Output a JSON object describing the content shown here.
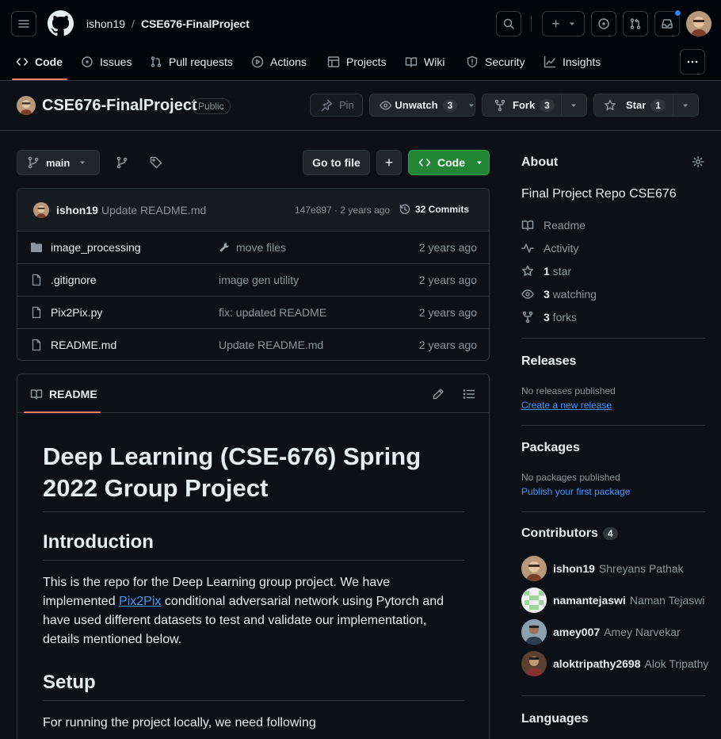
{
  "header": {
    "owner": "ishon19",
    "separator": "/",
    "repo": "CSE676-FinalProject",
    "plus_label": "+"
  },
  "nav": {
    "code": "Code",
    "issues": "Issues",
    "pulls": "Pull requests",
    "actions": "Actions",
    "projects": "Projects",
    "wiki": "Wiki",
    "security": "Security",
    "insights": "Insights"
  },
  "repo": {
    "name": "CSE676-FinalProject",
    "visibility": "Public",
    "pin": "Pin",
    "unwatch": "Unwatch",
    "watch_count": "3",
    "fork": "Fork",
    "fork_count": "3",
    "star": "Star",
    "star_count": "1"
  },
  "toolbar": {
    "branch": "main",
    "go_to_file": "Go to file",
    "add": "+",
    "code": "Code"
  },
  "commit": {
    "author": "ishon19",
    "message": "Update README.md",
    "hash_time": "147e897 · 2 years ago",
    "commits": "32 Commits"
  },
  "files": [
    {
      "name": "image_processing",
      "type": "folder",
      "message": "move files",
      "date": "2 years ago"
    },
    {
      "name": ".gitignore",
      "type": "file",
      "message": "image gen utility",
      "date": "2 years ago"
    },
    {
      "name": "Pix2Pix.py",
      "type": "file",
      "message": "fix: updated README",
      "date": "2 years ago"
    },
    {
      "name": "README.md",
      "type": "file",
      "message": "Update README.md",
      "date": "2 years ago"
    }
  ],
  "readme": {
    "tab": "README",
    "title": "Deep Learning (CSE-676) Spring 2022 Group Project",
    "intro_heading": "Introduction",
    "intro_p1": "This is the repo for the Deep Learning group project. We have implemented ",
    "intro_link": "Pix2Pix",
    "intro_p2": " conditional adversarial network using Pytorch and have used different datasets to test and validate our implementation, details mentioned below.",
    "setup_heading": "Setup",
    "setup_p": "For running the project locally, we need following"
  },
  "about": {
    "heading": "About",
    "description": "Final Project Repo CSE676",
    "readme": "Readme",
    "activity": "Activity",
    "stars_num": "1",
    "stars_label": " star",
    "watching_num": "3",
    "watching_label": " watching",
    "forks_num": "3",
    "forks_label": " forks"
  },
  "releases": {
    "heading": "Releases",
    "none": "No releases published",
    "create": "Create a new release"
  },
  "packages": {
    "heading": "Packages",
    "none": "No packages published",
    "publish": "Publish your first package"
  },
  "contributors": {
    "heading": "Contributors",
    "count": "4",
    "list": [
      {
        "login": "ishon19",
        "name": "Shreyans Pathak"
      },
      {
        "login": "namantejaswi",
        "name": "Naman Tejaswi"
      },
      {
        "login": "amey007",
        "name": "Amey Narvekar"
      },
      {
        "login": "aloktripathy2698",
        "name": "Alok Tripathy"
      }
    ]
  },
  "languages": {
    "heading": "Languages"
  },
  "colors": {
    "bg": "#0d1117",
    "header_bg": "#010409",
    "border": "#30363d",
    "accent_green": "#238636",
    "link": "#4493f8",
    "tab_underline": "#f78166",
    "notification": "#2f81f7"
  }
}
